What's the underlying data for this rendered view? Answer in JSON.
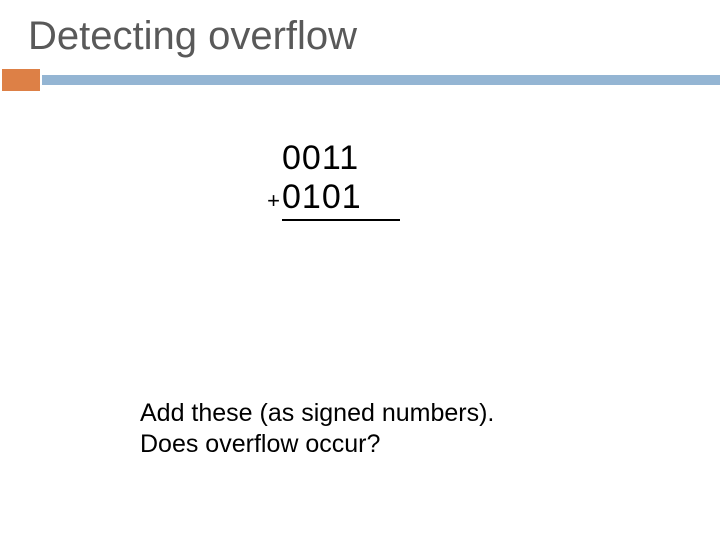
{
  "title": "Detecting overflow",
  "addition": {
    "operand1": "0011",
    "plus": "+",
    "operand2": "0101"
  },
  "prompt": {
    "line1": "Add these (as signed numbers).",
    "line2": "Does overflow occur?"
  }
}
